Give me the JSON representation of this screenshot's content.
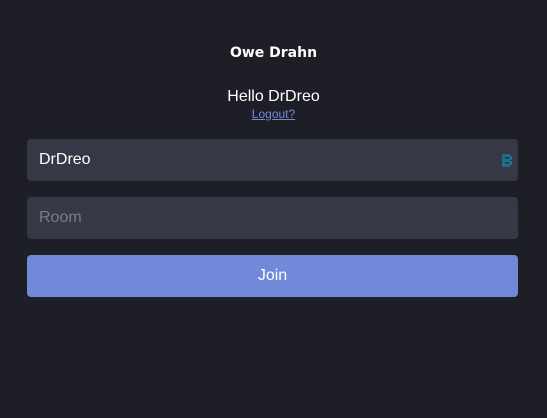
{
  "app": {
    "title": "Owe Drahn"
  },
  "user": {
    "greeting": "Hello DrDreo",
    "logout_label": "Logout?"
  },
  "form": {
    "username_value": "DrDreo",
    "room_value": "",
    "room_placeholder": "Room",
    "join_label": "Join"
  },
  "icons": {
    "username_field_icon": "password-manager-icon"
  },
  "colors": {
    "background": "#1e1f26",
    "field": "#363845",
    "accent": "#7289da",
    "icon": "#1d6f8a"
  }
}
